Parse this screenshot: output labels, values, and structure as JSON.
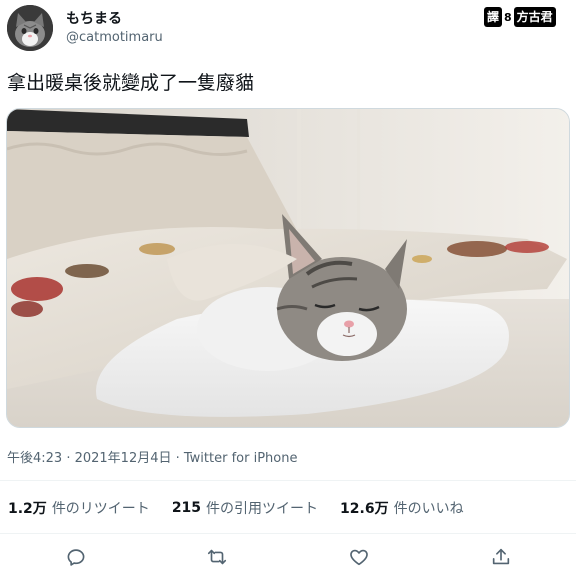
{
  "user": {
    "display_name": "もちまる",
    "handle": "@catmotimaru"
  },
  "translator_badge": {
    "left": "譯",
    "middle": "8",
    "right": "方古君"
  },
  "tweet": {
    "text": "拿出暖桌後就變成了一隻廢貓",
    "timestamp": "午後4:23 · 2021年12月4日 · Twitter for iPhone"
  },
  "stats": {
    "retweets": {
      "count": "1.2万",
      "label": "件のリツイート"
    },
    "quotes": {
      "count": "215",
      "label": "件の引用ツイート"
    },
    "likes": {
      "count": "12.6万",
      "label": "件のいいね"
    }
  },
  "icons": {
    "reply": "reply-icon",
    "retweet": "retweet-icon",
    "like": "heart-icon",
    "share": "share-icon"
  },
  "colors": {
    "text": "#0f1419",
    "secondary": "#536471",
    "divider": "#eff3f4"
  }
}
